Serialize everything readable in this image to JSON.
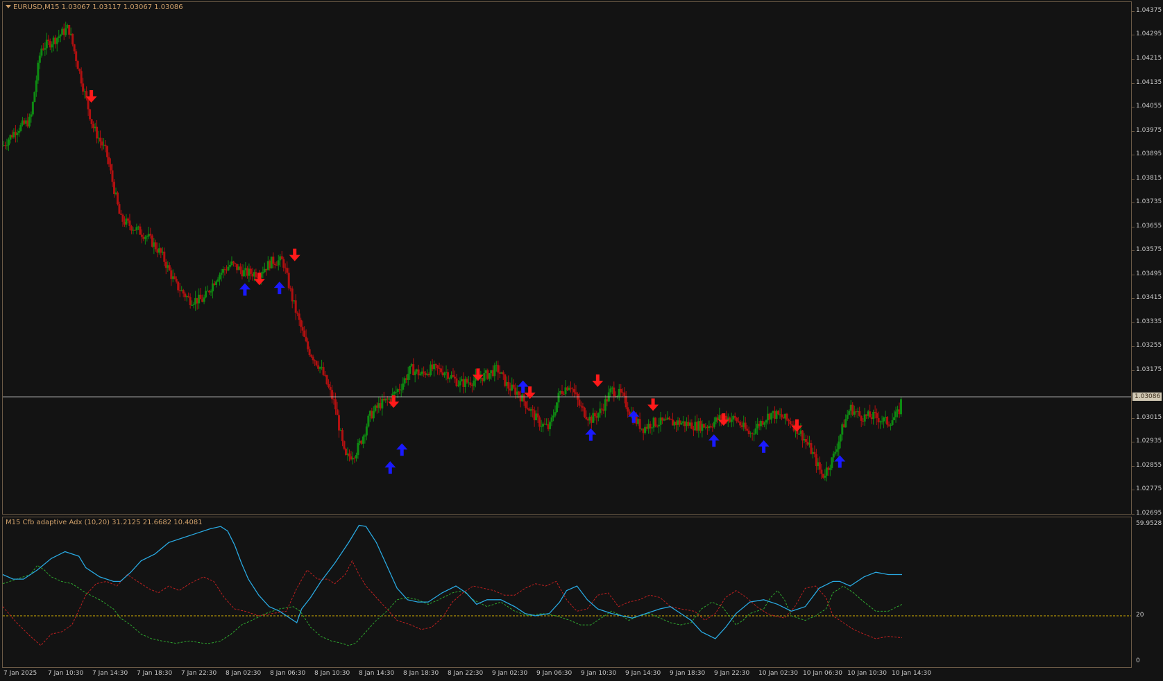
{
  "price_chart": {
    "title": "EURUSD,M15  1.03067 1.03117 1.03067 1.03086",
    "current_price": "1.03086",
    "y_ticks": [
      "1.04375",
      "1.04295",
      "1.04215",
      "1.04135",
      "1.04055",
      "1.03975",
      "1.03895",
      "1.03815",
      "1.03735",
      "1.03655",
      "1.03575",
      "1.03495",
      "1.03415",
      "1.03335",
      "1.03255",
      "1.03175",
      "1.03015",
      "1.02935",
      "1.02855",
      "1.02775",
      "1.02695"
    ],
    "colors": {
      "bull": "#0e8a12",
      "bear": "#b01010",
      "up_arrow": "#1a1aff",
      "down_arrow": "#ff1a1a",
      "price_line": "#d0d0d0",
      "border": "#6b5a46"
    }
  },
  "indicator": {
    "title": "M15 Cfb adaptive Adx (10,20) 31.2125 21.6682 10.4081",
    "y_ticks": [
      "59.9528",
      "20",
      "0"
    ],
    "level": 20,
    "colors": {
      "adx": "#29a8e0",
      "plus_di": "#2fa82f",
      "minus_di": "#c02020",
      "level_line": "#d4b000"
    }
  },
  "x_ticks": [
    "7 Jan 2025",
    "7 Jan 10:30",
    "7 Jan 14:30",
    "7 Jan 18:30",
    "7 Jan 22:30",
    "8 Jan 02:30",
    "8 Jan 06:30",
    "8 Jan 10:30",
    "8 Jan 14:30",
    "8 Jan 18:30",
    "8 Jan 22:30",
    "9 Jan 02:30",
    "9 Jan 06:30",
    "9 Jan 10:30",
    "9 Jan 14:30",
    "9 Jan 18:30",
    "9 Jan 22:30",
    "10 Jan 02:30",
    "10 Jan 06:30",
    "10 Jan 10:30",
    "10 Jan 14:30"
  ],
  "chart_data": {
    "type": "line",
    "price_path": [
      [
        0,
        1.03925
      ],
      [
        20,
        1.0398
      ],
      [
        40,
        1.0401
      ],
      [
        55,
        1.0425
      ],
      [
        75,
        1.0428
      ],
      [
        95,
        1.0432
      ],
      [
        110,
        1.0418
      ],
      [
        130,
        1.0399
      ],
      [
        150,
        1.039
      ],
      [
        170,
        1.0368
      ],
      [
        190,
        1.0365
      ],
      [
        210,
        1.0362
      ],
      [
        230,
        1.0356
      ],
      [
        250,
        1.0346
      ],
      [
        270,
        1.0341
      ],
      [
        290,
        1.0341
      ],
      [
        310,
        1.0349
      ],
      [
        330,
        1.0353
      ],
      [
        350,
        1.035
      ],
      [
        370,
        1.035
      ],
      [
        390,
        1.0354
      ],
      [
        405,
        1.0354
      ],
      [
        420,
        1.034
      ],
      [
        440,
        1.0325
      ],
      [
        460,
        1.0318
      ],
      [
        480,
        1.0306
      ],
      [
        495,
        1.0288
      ],
      [
        510,
        1.029
      ],
      [
        520,
        1.0295
      ],
      [
        530,
        1.0302
      ],
      [
        545,
        1.0306
      ],
      [
        560,
        1.0308
      ],
      [
        575,
        1.0312
      ],
      [
        590,
        1.0318
      ],
      [
        605,
        1.0316
      ],
      [
        620,
        1.0318
      ],
      [
        640,
        1.0317
      ],
      [
        660,
        1.0313
      ],
      [
        680,
        1.0314
      ],
      [
        700,
        1.0316
      ],
      [
        715,
        1.0318
      ],
      [
        730,
        1.0312
      ],
      [
        745,
        1.031
      ],
      [
        760,
        1.0305
      ],
      [
        775,
        1.03
      ],
      [
        790,
        1.0298
      ],
      [
        805,
        1.031
      ],
      [
        820,
        1.0313
      ],
      [
        835,
        1.0305
      ],
      [
        850,
        1.0301
      ],
      [
        865,
        1.0304
      ],
      [
        880,
        1.0311
      ],
      [
        895,
        1.0309
      ],
      [
        910,
        1.0302
      ],
      [
        925,
        1.0298
      ],
      [
        940,
        1.03
      ],
      [
        960,
        1.03
      ],
      [
        980,
        1.03
      ],
      [
        1000,
        1.0299
      ],
      [
        1020,
        1.0299
      ],
      [
        1040,
        1.0302
      ],
      [
        1060,
        1.0301
      ],
      [
        1080,
        1.0296
      ],
      [
        1095,
        1.03
      ],
      [
        1110,
        1.0303
      ],
      [
        1125,
        1.0302
      ],
      [
        1140,
        1.03
      ],
      [
        1155,
        1.0296
      ],
      [
        1170,
        1.029
      ],
      [
        1185,
        1.0282
      ],
      [
        1200,
        1.0288
      ],
      [
        1215,
        1.0299
      ],
      [
        1225,
        1.0305
      ],
      [
        1240,
        1.0302
      ],
      [
        1260,
        1.0302
      ],
      [
        1280,
        1.03
      ],
      [
        1295,
        1.0303
      ],
      [
        1300,
        1.03086
      ]
    ],
    "up_arrows": [
      [
        350,
        1.03445
      ],
      [
        400,
        1.0345
      ],
      [
        560,
        1.0285
      ],
      [
        577,
        1.0291
      ],
      [
        752,
        1.0312
      ],
      [
        850,
        1.0296
      ],
      [
        912,
        1.0302
      ],
      [
        1028,
        1.0294
      ],
      [
        1100,
        1.0292
      ],
      [
        1210,
        1.0287
      ]
    ],
    "down_arrows": [
      [
        128,
        1.0409
      ],
      [
        371,
        1.0348
      ],
      [
        422,
        1.0356
      ],
      [
        565,
        1.0307
      ],
      [
        687,
        1.0316
      ],
      [
        762,
        1.031
      ],
      [
        860,
        1.0314
      ],
      [
        940,
        1.0306
      ],
      [
        1042,
        1.0301
      ],
      [
        1148,
        1.0299
      ]
    ],
    "adx": [
      [
        0,
        38
      ],
      [
        15,
        36
      ],
      [
        30,
        36
      ],
      [
        50,
        40
      ],
      [
        70,
        45
      ],
      [
        90,
        48
      ],
      [
        100,
        47
      ],
      [
        110,
        46
      ],
      [
        120,
        41
      ],
      [
        140,
        37
      ],
      [
        160,
        35
      ],
      [
        170,
        35
      ],
      [
        185,
        39
      ],
      [
        200,
        44
      ],
      [
        220,
        47
      ],
      [
        240,
        52
      ],
      [
        260,
        54
      ],
      [
        280,
        56
      ],
      [
        300,
        58
      ],
      [
        315,
        59
      ],
      [
        325,
        57
      ],
      [
        335,
        51
      ],
      [
        345,
        43
      ],
      [
        355,
        36
      ],
      [
        370,
        29
      ],
      [
        385,
        24
      ],
      [
        400,
        22
      ],
      [
        415,
        19
      ],
      [
        425,
        17
      ],
      [
        432,
        23
      ],
      [
        445,
        28
      ],
      [
        460,
        35
      ],
      [
        480,
        43
      ],
      [
        500,
        52
      ],
      [
        515,
        59.5
      ],
      [
        525,
        59
      ],
      [
        540,
        52
      ],
      [
        555,
        42
      ],
      [
        570,
        32
      ],
      [
        585,
        27
      ],
      [
        600,
        26
      ],
      [
        615,
        26
      ],
      [
        635,
        30
      ],
      [
        655,
        33
      ],
      [
        670,
        30
      ],
      [
        685,
        25
      ],
      [
        700,
        27
      ],
      [
        720,
        27
      ],
      [
        740,
        24
      ],
      [
        755,
        21
      ],
      [
        770,
        20
      ],
      [
        790,
        21
      ],
      [
        805,
        26
      ],
      [
        815,
        31
      ],
      [
        830,
        33
      ],
      [
        845,
        27
      ],
      [
        860,
        23
      ],
      [
        880,
        21
      ],
      [
        895,
        20
      ],
      [
        910,
        19
      ],
      [
        930,
        21
      ],
      [
        950,
        23
      ],
      [
        965,
        24
      ],
      [
        980,
        21
      ],
      [
        995,
        18
      ],
      [
        1010,
        13
      ],
      [
        1030,
        10
      ],
      [
        1045,
        15
      ],
      [
        1060,
        21
      ],
      [
        1080,
        26
      ],
      [
        1100,
        27
      ],
      [
        1120,
        25
      ],
      [
        1140,
        22
      ],
      [
        1160,
        24
      ],
      [
        1180,
        32
      ],
      [
        1200,
        35
      ],
      [
        1210,
        35
      ],
      [
        1225,
        33
      ],
      [
        1245,
        37
      ],
      [
        1262,
        39
      ],
      [
        1280,
        38
      ],
      [
        1300,
        38
      ]
    ],
    "plus_di": [
      [
        0,
        34
      ],
      [
        20,
        36
      ],
      [
        40,
        38
      ],
      [
        50,
        42
      ],
      [
        60,
        40
      ],
      [
        70,
        37
      ],
      [
        85,
        35
      ],
      [
        100,
        34
      ],
      [
        120,
        30
      ],
      [
        140,
        27
      ],
      [
        160,
        23
      ],
      [
        170,
        19
      ],
      [
        185,
        16
      ],
      [
        200,
        12
      ],
      [
        215,
        10
      ],
      [
        230,
        9
      ],
      [
        250,
        8
      ],
      [
        270,
        9
      ],
      [
        290,
        8
      ],
      [
        300,
        8
      ],
      [
        315,
        9
      ],
      [
        330,
        12
      ],
      [
        345,
        16
      ],
      [
        360,
        18
      ],
      [
        380,
        21
      ],
      [
        400,
        23
      ],
      [
        420,
        24
      ],
      [
        430,
        22
      ],
      [
        445,
        15
      ],
      [
        460,
        11
      ],
      [
        475,
        9
      ],
      [
        490,
        8
      ],
      [
        500,
        7
      ],
      [
        510,
        8
      ],
      [
        525,
        13
      ],
      [
        540,
        18
      ],
      [
        555,
        22
      ],
      [
        570,
        27
      ],
      [
        585,
        28
      ],
      [
        600,
        27
      ],
      [
        615,
        25
      ],
      [
        630,
        27
      ],
      [
        650,
        30
      ],
      [
        665,
        31
      ],
      [
        680,
        27
      ],
      [
        700,
        24
      ],
      [
        720,
        26
      ],
      [
        740,
        22
      ],
      [
        760,
        20
      ],
      [
        780,
        21
      ],
      [
        800,
        20
      ],
      [
        820,
        18
      ],
      [
        835,
        16
      ],
      [
        850,
        16
      ],
      [
        865,
        19
      ],
      [
        880,
        22
      ],
      [
        895,
        20
      ],
      [
        905,
        18
      ],
      [
        920,
        20
      ],
      [
        935,
        21
      ],
      [
        950,
        19
      ],
      [
        965,
        17
      ],
      [
        980,
        16
      ],
      [
        995,
        17
      ],
      [
        1010,
        23
      ],
      [
        1025,
        26
      ],
      [
        1040,
        24
      ],
      [
        1050,
        20
      ],
      [
        1060,
        16
      ],
      [
        1070,
        18
      ],
      [
        1080,
        21
      ],
      [
        1100,
        23
      ],
      [
        1110,
        28
      ],
      [
        1120,
        31
      ],
      [
        1130,
        27
      ],
      [
        1140,
        20
      ],
      [
        1160,
        18
      ],
      [
        1175,
        20
      ],
      [
        1190,
        23
      ],
      [
        1200,
        30
      ],
      [
        1215,
        33
      ],
      [
        1230,
        30
      ],
      [
        1245,
        26
      ],
      [
        1262,
        22
      ],
      [
        1280,
        22
      ],
      [
        1300,
        25
      ]
    ],
    "minus_di": [
      [
        0,
        24
      ],
      [
        20,
        17
      ],
      [
        40,
        11
      ],
      [
        55,
        7
      ],
      [
        70,
        12
      ],
      [
        85,
        13
      ],
      [
        100,
        16
      ],
      [
        120,
        29
      ],
      [
        135,
        34
      ],
      [
        150,
        35
      ],
      [
        165,
        33
      ],
      [
        180,
        38
      ],
      [
        195,
        35
      ],
      [
        210,
        32
      ],
      [
        225,
        30
      ],
      [
        240,
        33
      ],
      [
        255,
        31
      ],
      [
        270,
        34
      ],
      [
        290,
        37
      ],
      [
        305,
        35
      ],
      [
        320,
        28
      ],
      [
        335,
        23
      ],
      [
        350,
        22
      ],
      [
        370,
        20
      ],
      [
        390,
        21
      ],
      [
        410,
        22
      ],
      [
        425,
        32
      ],
      [
        440,
        40
      ],
      [
        455,
        36
      ],
      [
        470,
        36
      ],
      [
        480,
        34
      ],
      [
        495,
        38
      ],
      [
        505,
        44
      ],
      [
        515,
        38
      ],
      [
        525,
        33
      ],
      [
        540,
        28
      ],
      [
        555,
        23
      ],
      [
        570,
        18
      ],
      [
        590,
        16
      ],
      [
        605,
        14
      ],
      [
        620,
        15
      ],
      [
        635,
        19
      ],
      [
        650,
        26
      ],
      [
        665,
        30
      ],
      [
        680,
        33
      ],
      [
        695,
        32
      ],
      [
        710,
        31
      ],
      [
        725,
        29
      ],
      [
        740,
        29
      ],
      [
        755,
        32
      ],
      [
        770,
        34
      ],
      [
        785,
        33
      ],
      [
        800,
        35
      ],
      [
        815,
        27
      ],
      [
        830,
        22
      ],
      [
        845,
        23
      ],
      [
        860,
        29
      ],
      [
        875,
        30
      ],
      [
        890,
        24
      ],
      [
        905,
        26
      ],
      [
        920,
        27
      ],
      [
        935,
        29
      ],
      [
        950,
        28
      ],
      [
        965,
        24
      ],
      [
        980,
        23
      ],
      [
        1000,
        22
      ],
      [
        1015,
        18
      ],
      [
        1030,
        21
      ],
      [
        1045,
        28
      ],
      [
        1060,
        31
      ],
      [
        1075,
        28
      ],
      [
        1090,
        24
      ],
      [
        1105,
        21
      ],
      [
        1115,
        20
      ],
      [
        1130,
        19
      ],
      [
        1145,
        24
      ],
      [
        1160,
        32
      ],
      [
        1175,
        33
      ],
      [
        1190,
        28
      ],
      [
        1200,
        20
      ],
      [
        1215,
        17
      ],
      [
        1230,
        14
      ],
      [
        1245,
        12
      ],
      [
        1262,
        10
      ],
      [
        1280,
        11
      ],
      [
        1300,
        10.4
      ]
    ]
  }
}
